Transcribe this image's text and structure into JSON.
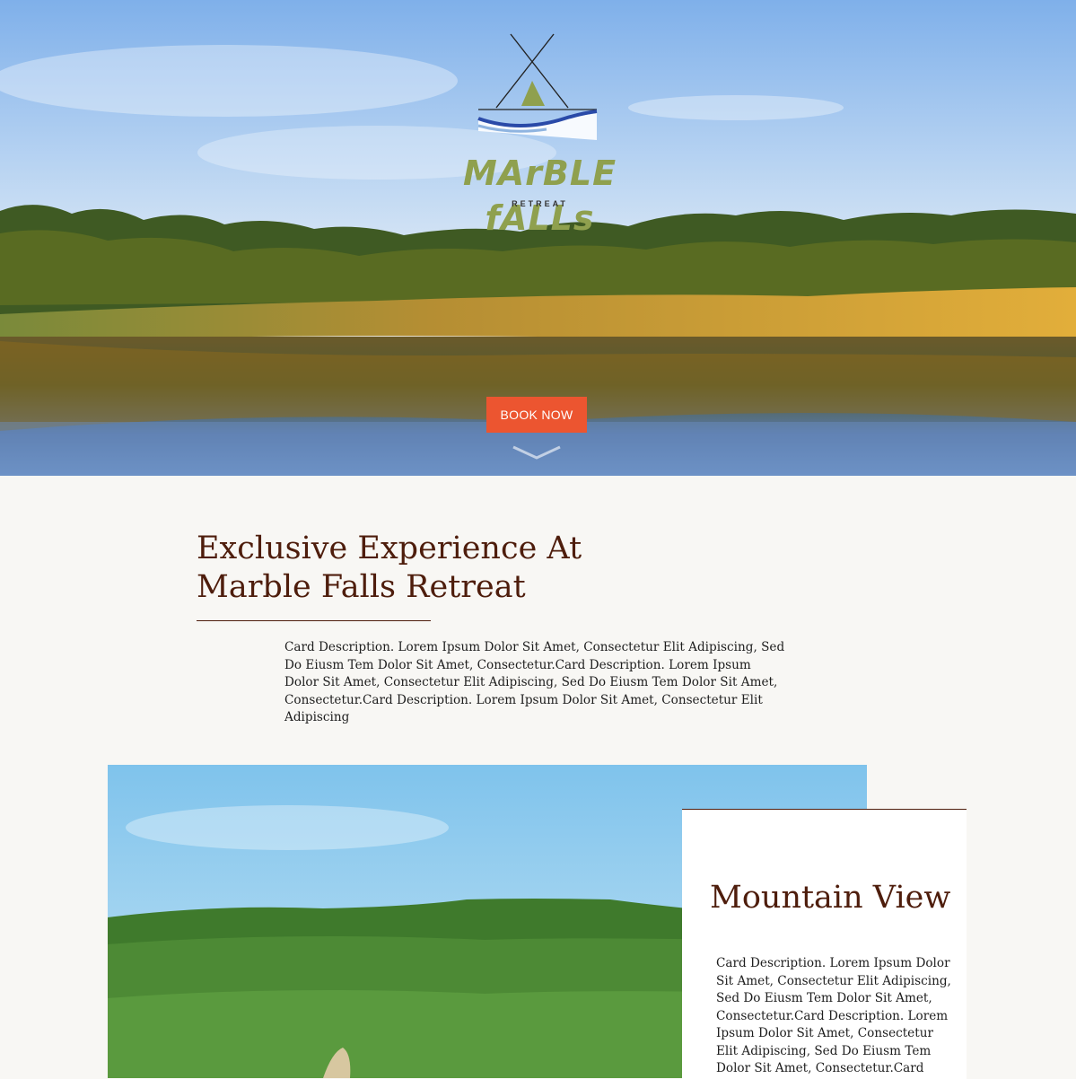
{
  "hero": {
    "brand_name": "MArBLE fALLs",
    "brand_tagline": "RETREAT",
    "book_button": "BOOK NOW",
    "scroll_icon": "chevron-down-icon"
  },
  "intro": {
    "title_line1": "Exclusive Experience At",
    "title_line2": "Marble Falls Retreat",
    "description": "Card Description. Lorem Ipsum Dolor Sit Amet, Consectetur Elit Adipiscing, Sed Do Eiusm Tem Dolor Sit Amet, Consectetur.Card Description. Lorem Ipsum Dolor Sit Amet, Consectetur Elit Adipiscing, Sed Do Eiusm Tem Dolor Sit Amet, Consectetur.Card Description. Lorem Ipsum Dolor Sit Amet, Consectetur Elit Adipiscing"
  },
  "feature": {
    "title": "Mountain View",
    "description": "Card Description. Lorem Ipsum Dolor Sit Amet, Consectetur Elit Adipiscing, Sed Do Eiusm Tem Dolor Sit Amet, Consectetur.Card Description. Lorem Ipsum Dolor Sit Amet, Consectetur Elit Adipiscing, Sed Do Eiusm Tem Dolor Sit Amet, Consectetur.Card"
  },
  "colors": {
    "accent": "#ec5530",
    "heading": "#4e1d0c",
    "brand_green": "#8fa04e",
    "page_bg": "#f8f7f4"
  }
}
